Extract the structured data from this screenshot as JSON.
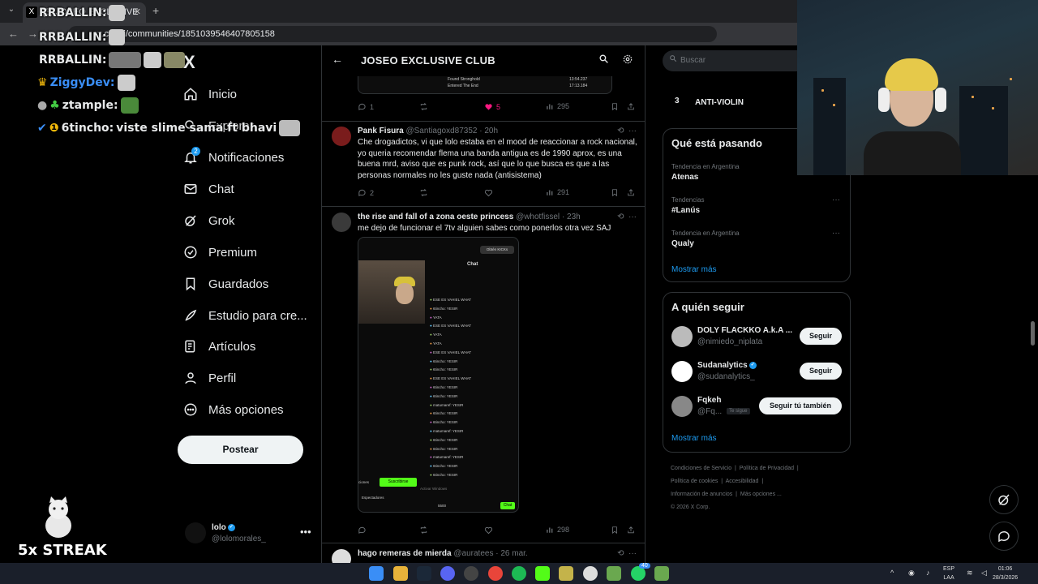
{
  "browser": {
    "tab_title": "(3) JOSEO EXCLUSIVE",
    "tab_favicon": "X",
    "url": "x.com/i/communities/1851039546407805158"
  },
  "sidebar": {
    "logo": "X",
    "items": [
      {
        "label": "Inicio",
        "icon": "home-icon"
      },
      {
        "label": "Explorar",
        "icon": "search-icon"
      },
      {
        "label": "Notificaciones",
        "icon": "bell-icon",
        "badge": "2"
      },
      {
        "label": "Chat",
        "icon": "mail-icon"
      },
      {
        "label": "Grok",
        "icon": "grok-icon"
      },
      {
        "label": "Premium",
        "icon": "verified-icon"
      },
      {
        "label": "Guardados",
        "icon": "bookmark-icon"
      },
      {
        "label": "Estudio para cre...",
        "icon": "rocket-icon"
      },
      {
        "label": "Artículos",
        "icon": "article-icon"
      },
      {
        "label": "Perfil",
        "icon": "person-icon"
      },
      {
        "label": "Más opciones",
        "icon": "more-circle-icon"
      }
    ],
    "post_button": "Postear",
    "profile": {
      "name": "lolo",
      "handle": "@lolomorales_",
      "more": "•••"
    }
  },
  "main": {
    "header_title": "JOSEO EXCLUSIVE CLUB",
    "top_image_rows": [
      "Found Stronghold",
      "Entered The End"
    ],
    "top_image_times": [
      "13:54.237",
      "17:13.184"
    ],
    "tweet0_actions": {
      "replies": "1",
      "likes": "5",
      "views": "295"
    },
    "tweets": [
      {
        "name": "Pank Fisura",
        "handle": "@Santiagoxd87352",
        "time": "20h",
        "text": "Che drogadictos, vi que lolo estaba en el mood de reaccionar a rock nacional, yo queria recomendar flema una banda antigua es de 1990 aprox, es una buena mrd, aviso que es punk rock, así que lo que busca es que a las personas normales no les guste nada (antisistema)",
        "replies": "2",
        "views": "291"
      },
      {
        "name": "the rise and fall of a zona oeste princess",
        "handle": "@whotfissel",
        "time": "23h",
        "text": "me dejo de funcionar el 7tv alguien sabes como ponerlos otra vez SAJ",
        "views": "298"
      },
      {
        "name": "hago remeras de mierda",
        "handle": "@auratees",
        "time": "26 mar."
      }
    ],
    "media": {
      "kick_button": "Obtén KICKs",
      "chat_title": "Chat",
      "chat_lines": [
        "ESE ES VAHIEL WHAT",
        "6tincho: YESIR",
        "YATA",
        "ESE ES VAHIEL WHAT",
        "YATA",
        "YATA",
        "ESE ES VAHIEL WHAT",
        "6tincho: YESIR",
        "6tincho: YESIR",
        "ESE ES VAHIEL WHAT",
        "6tincho: YESIR",
        "6tincho: YESIR",
        "matumaref: YESIR",
        "6tincho: YESIR",
        "6tincho: YESIR",
        "matumaref: YESIR",
        "6tincho: YESIR",
        "6tincho: YESIR",
        "matumaref: YESIR",
        "6tincho: YESIR",
        "6tincho: YESIR"
      ],
      "suscribirse": "Suscribirse",
      "chat_button": "Chat",
      "viewers": "5500",
      "espectadores": "Espectadores",
      "acciones": "ciones",
      "activate": "Activar Windows"
    }
  },
  "right": {
    "search_placeholder": "Buscar",
    "top_trend_rank": "3",
    "top_trend_name": "ANTI-VIOLIN",
    "whats_happening": {
      "title": "Qué está pasando",
      "trends": [
        {
          "context": "Tendencia en Argentina",
          "name": "Atenas"
        },
        {
          "context": "Tendencias",
          "name": "#Lanús"
        },
        {
          "context": "Tendencia en Argentina",
          "name": "Qualy"
        }
      ],
      "show_more": "Mostrar más"
    },
    "who_to_follow": {
      "title": "A quién seguir",
      "users": [
        {
          "name": "DOLY FLACKKO A.k.A ...",
          "handle": "@nimiedo_niplata",
          "button": "Seguir"
        },
        {
          "name": "Sudanalytics",
          "handle": "@sudanalytics_",
          "button": "Seguir"
        },
        {
          "name": "Fqkeh",
          "handle": "@Fq...",
          "badge": "Te sigue",
          "button": "Seguir tú también"
        }
      ],
      "show_more": "Mostrar más"
    },
    "footer": [
      "Condiciones de Servicio",
      "Política de Privacidad",
      "Política de cookies",
      "Accesibilidad",
      "Información de anuncios",
      "Más opciones ...",
      "© 2026 X Corp."
    ]
  },
  "stream_overlay": {
    "chat": [
      {
        "user": "RRBALLIN:",
        "text": "",
        "color": "#ffffff"
      },
      {
        "user": "RRBALLIN:",
        "text": "",
        "color": "#ffffff"
      },
      {
        "user": "RRBALLIN:",
        "text": "",
        "color": "#ffffff"
      },
      {
        "user": "ZiggyDev:",
        "text": "",
        "color": "#3a8ef6"
      },
      {
        "user": "ztample:",
        "text": "",
        "color": "#ffffff"
      },
      {
        "user": "6tincho:",
        "text": " viste slime sama ft bhavi",
        "color": "#ffffff"
      }
    ],
    "streak": "5x STREAK"
  },
  "taskbar": {
    "lang": "ESP",
    "lang2": "LAA",
    "time": "01:06",
    "date": "28/3/2026",
    "whatsapp_badge": "40"
  },
  "colors": {
    "accent": "#1d9bf0",
    "like": "#f91880",
    "kick_green": "#53fc18"
  }
}
